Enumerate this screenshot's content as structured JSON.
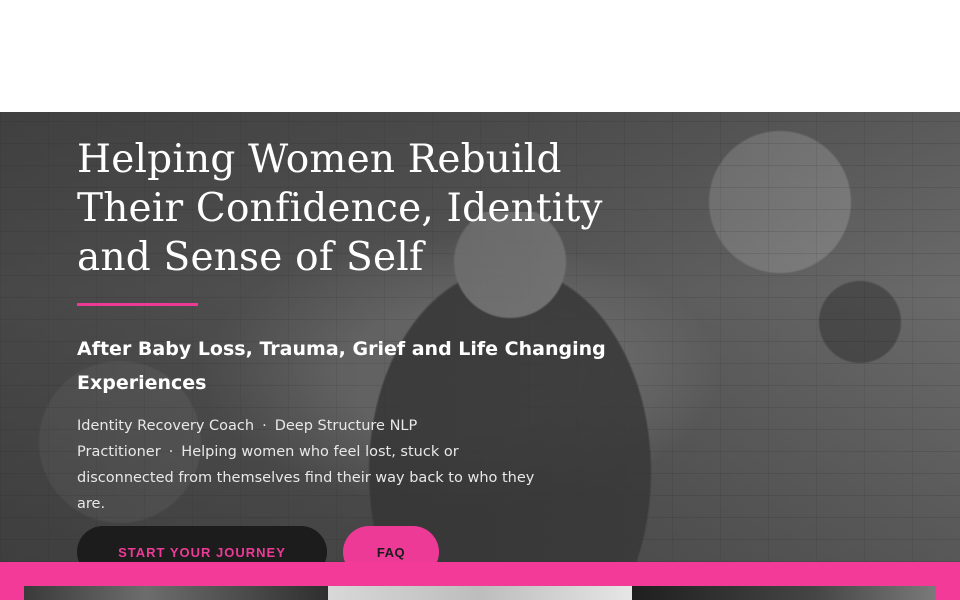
{
  "hero": {
    "headline": "Helping Women Rebuild Their Confidence, Identity and Sense of Self",
    "subheadline": "After Baby Loss, Trauma, Grief and Life Changing Experiences",
    "credential_1": "Identity Recovery Coach",
    "credential_2": "Deep Structure NLP Practitioner",
    "separator": "·",
    "description": "Helping women who feel lost, stuck or disconnected from themselves find their way back to who they are."
  },
  "buttons": {
    "primary_label": "START YOUR JOURNEY",
    "secondary_label": "FAQ"
  },
  "colors": {
    "accent": "#ee3a97",
    "band": "#f33a98",
    "dark_button": "#1c1c1c"
  }
}
